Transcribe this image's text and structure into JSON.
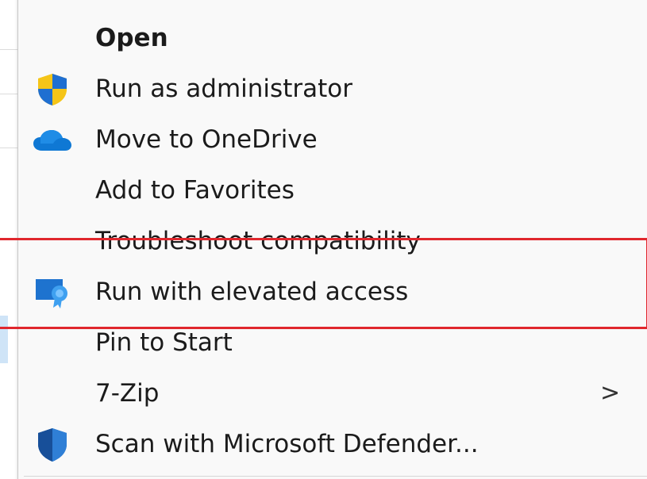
{
  "context_menu": {
    "items": [
      {
        "label": "Open",
        "icon": "none",
        "bold": true
      },
      {
        "label": "Run as administrator",
        "icon": "uac-shield-icon"
      },
      {
        "label": "Move to OneDrive",
        "icon": "onedrive-cloud-icon"
      },
      {
        "label": "Add to Favorites",
        "icon": "none"
      },
      {
        "label": "Troubleshoot compatibility",
        "icon": "none"
      },
      {
        "label": "Run with elevated access",
        "icon": "elevated-access-badge-icon"
      },
      {
        "label": "Pin to Start",
        "icon": "none"
      },
      {
        "label": "7-Zip",
        "icon": "none",
        "submenu_arrow": ">"
      },
      {
        "label": "Scan with Microsoft Defender...",
        "icon": "defender-shield-icon"
      }
    ]
  },
  "annotation": {
    "highlight_color": "#e0272d",
    "highlighted_item": "Run with elevated access"
  },
  "colors": {
    "menu_background": "#f9f9f9",
    "text": "#1b1b1b",
    "shield_blue": "#1f6fd1",
    "shield_yellow": "#f5c518",
    "onedrive_blue": "#0f78d4",
    "defender_blue": "#1a5fb4"
  }
}
